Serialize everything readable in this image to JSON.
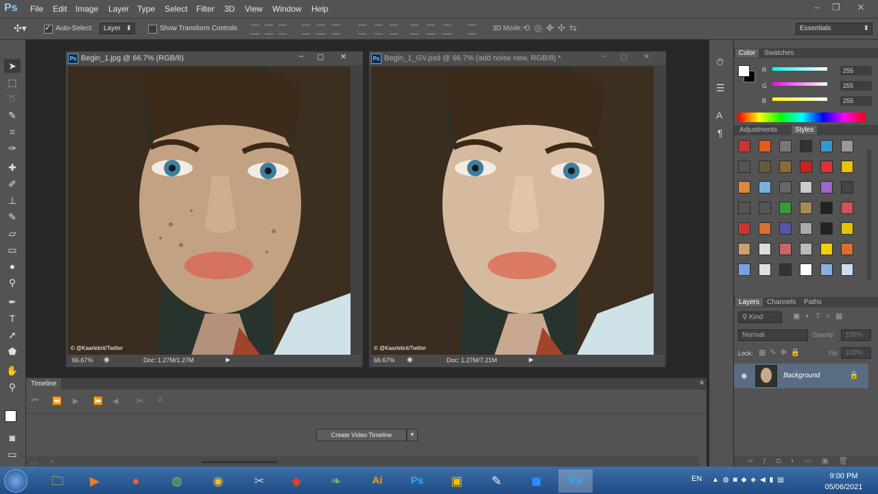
{
  "menubar": {
    "logo": "Ps",
    "items": [
      "File",
      "Edit",
      "Image",
      "Layer",
      "Type",
      "Select",
      "Filter",
      "3D",
      "View",
      "Window",
      "Help"
    ]
  },
  "options": {
    "auto_select_label": "Auto-Select:",
    "auto_select_value": "Layer",
    "transform_label": "Show Transform Controls",
    "mode_3d_label": "3D Mode:",
    "workspace": "Essentials"
  },
  "docs": [
    {
      "title": "Begin_1.jpg @ 66.7% (RGB/8)",
      "zoom": "66.67%",
      "doc_info": "Doc: 1.27M/1.27M",
      "watermark": "© @Kaarlebrit/Twitter"
    },
    {
      "title": "Begin_1_GV.psd @ 66.7% (add noise new, RGB/8) *",
      "zoom": "66.67%",
      "doc_info": "Doc: 1.27M/7.21M",
      "watermark": "© @Kaarlebrit/Twitter"
    }
  ],
  "timeline": {
    "tab": "Timeline",
    "create_button": "Create Video Timeline"
  },
  "color_panel": {
    "tabs": [
      "Color",
      "Swatches"
    ],
    "channels": [
      {
        "label": "R",
        "value": "255"
      },
      {
        "label": "G",
        "value": "255"
      },
      {
        "label": "B",
        "value": "255"
      }
    ]
  },
  "styles_panel": {
    "tabs": [
      "Adjustments",
      "Styles"
    ]
  },
  "layers_panel": {
    "tabs": [
      "Layers",
      "Channels",
      "Paths"
    ],
    "kind": "Kind",
    "blend": "Normal",
    "opacity_label": "Opacity:",
    "opacity_value": "100%",
    "lock_label": "Lock:",
    "fill_label": "Fill:",
    "fill_value": "100%",
    "layer_name": "Background"
  },
  "taskbar": {
    "lang": "EN",
    "time": "9:00 PM",
    "date": "05/06/2021"
  },
  "colors": {
    "accent": "#5fa7df",
    "panel": "#535353",
    "workspace": "#282828"
  }
}
